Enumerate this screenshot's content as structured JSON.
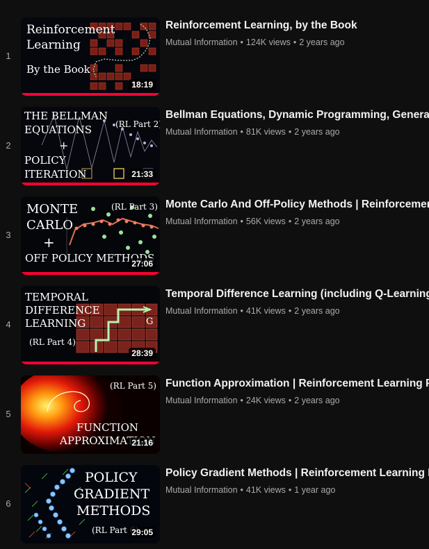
{
  "playlist": {
    "items": [
      {
        "index": "1",
        "title": "Reinforcement Learning, by the Book",
        "channel": "Mutual Information",
        "views": "124K views",
        "age": "2 years ago",
        "duration": "18:19",
        "progress": 1.0,
        "thumb_lines": [
          "Reinforcement",
          "Learning",
          "By the Book"
        ]
      },
      {
        "index": "2",
        "title": "Bellman Equations, Dynamic Programming, Generaliz",
        "channel": "Mutual Information",
        "views": "81K views",
        "age": "2 years ago",
        "duration": "21:33",
        "progress": 1.0,
        "thumb_lines": [
          "THE BELLMAN",
          "EQUATIONS",
          "+",
          "POLICY",
          "ITERATION",
          "(RL Part 2)"
        ]
      },
      {
        "index": "3",
        "title": "Monte Carlo And Off-Policy Methods | Reinforcement",
        "channel": "Mutual Information",
        "views": "56K views",
        "age": "2 years ago",
        "duration": "27:06",
        "progress": 1.0,
        "thumb_lines": [
          "MONTE",
          "CARLO",
          "+",
          "OFF POLICY METHODS",
          "(RL Part 3)"
        ]
      },
      {
        "index": "4",
        "title": "Temporal Difference Learning (including Q-Learning)",
        "channel": "Mutual Information",
        "views": "41K views",
        "age": "2 years ago",
        "duration": "28:39",
        "progress": 1.0,
        "thumb_lines": [
          "TEMPORAL",
          "DIFFERENCE",
          "LEARNING",
          "(RL Part 4)",
          "G"
        ]
      },
      {
        "index": "5",
        "title": "Function Approximation | Reinforcement Learning Par",
        "channel": "Mutual Information",
        "views": "24K views",
        "age": "2 years ago",
        "duration": "21:16",
        "progress": 0,
        "thumb_lines": [
          "(RL Part 5)",
          "FUNCTION",
          "APPROXIMATION"
        ]
      },
      {
        "index": "6",
        "title": "Policy Gradient Methods | Reinforcement Learning Pa",
        "channel": "Mutual Information",
        "views": "41K views",
        "age": "1 year ago",
        "duration": "29:05",
        "progress": 0,
        "thumb_lines": [
          "POLICY",
          "GRADIENT",
          "METHODS",
          "(RL Part 6)"
        ]
      }
    ],
    "separator": "•"
  },
  "colors": {
    "background": "#0f0f0f",
    "progress": "#ff0033",
    "secondary_text": "#aaaaaa"
  }
}
